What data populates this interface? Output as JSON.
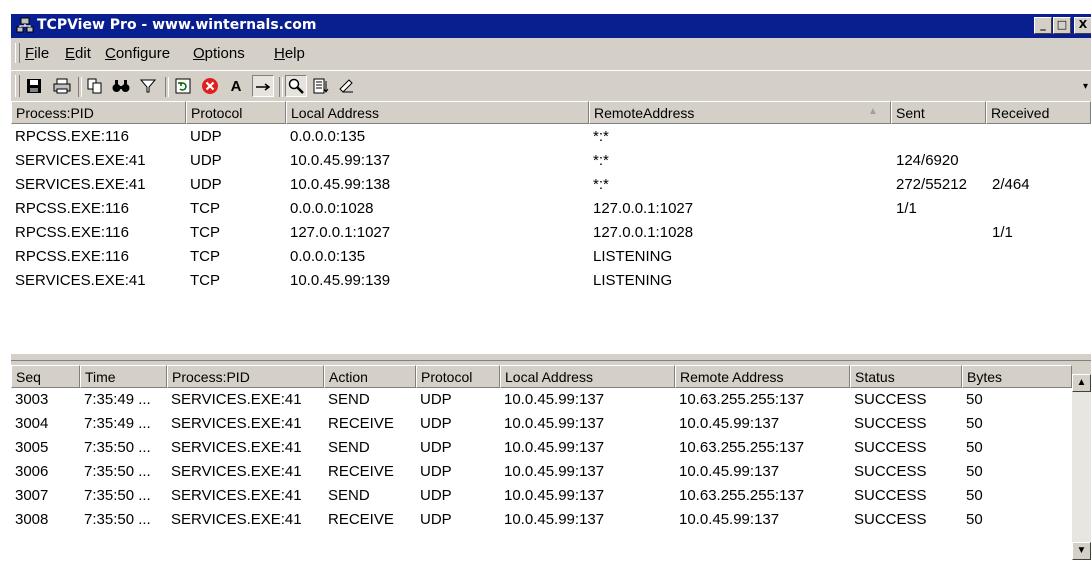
{
  "window": {
    "title": "TCPView Pro - www.winternals.com",
    "controls": {
      "minimize": "_",
      "maximize": "□",
      "close": "X"
    }
  },
  "menu": [
    {
      "label": "File",
      "accel": "F",
      "rest": "ile"
    },
    {
      "label": "Edit",
      "accel": "E",
      "rest": "dit"
    },
    {
      "label": "Configure",
      "accel": "C",
      "rest": "onfigure"
    },
    {
      "label": "Options",
      "accel": "O",
      "rest": "ptions"
    },
    {
      "label": "Help",
      "accel": "H",
      "rest": "elp"
    }
  ],
  "toolbar": {
    "icons": [
      "save-icon",
      "print-icon",
      "copy-icon",
      "find-icon",
      "filter-icon",
      "refresh-icon",
      "close-connection-icon",
      "font-icon",
      "resolve-address-icon",
      "zoom-icon",
      "properties-icon",
      "clear-icon"
    ],
    "font_glyph": "A"
  },
  "connections": {
    "columns": [
      "Process:PID",
      "Protocol",
      "Local Address",
      "RemoteAddress",
      "Sent",
      "Received"
    ],
    "sort_indicator": "▲",
    "rows": [
      {
        "process": "RPCSS.EXE:116",
        "protocol": "UDP",
        "local": "0.0.0.0:135",
        "remote": "*:*",
        "sent": "",
        "received": ""
      },
      {
        "process": "SERVICES.EXE:41",
        "protocol": "UDP",
        "local": "10.0.45.99:137",
        "remote": "*:*",
        "sent": "124/6920",
        "received": ""
      },
      {
        "process": "SERVICES.EXE:41",
        "protocol": "UDP",
        "local": "10.0.45.99:138",
        "remote": "*:*",
        "sent": "272/55212",
        "received": "2/464"
      },
      {
        "process": "RPCSS.EXE:116",
        "protocol": "TCP",
        "local": "0.0.0.0:1028",
        "remote": "127.0.0.1:1027",
        "sent": "1/1",
        "received": ""
      },
      {
        "process": "RPCSS.EXE:116",
        "protocol": "TCP",
        "local": "127.0.0.1:1027",
        "remote": "127.0.0.1:1028",
        "sent": "",
        "received": "1/1"
      },
      {
        "process": "RPCSS.EXE:116",
        "protocol": "TCP",
        "local": "0.0.0.0:135",
        "remote": "LISTENING",
        "sent": "",
        "received": ""
      },
      {
        "process": "SERVICES.EXE:41",
        "protocol": "TCP",
        "local": "10.0.45.99:139",
        "remote": "LISTENING",
        "sent": "",
        "received": ""
      }
    ]
  },
  "log": {
    "columns": [
      "Seq",
      "Time",
      "Process:PID",
      "Action",
      "Protocol",
      "Local Address",
      "Remote Address",
      "Status",
      "Bytes"
    ],
    "rows": [
      {
        "seq": "3003",
        "time": "7:35:49 ...",
        "process": "SERVICES.EXE:41",
        "action": "SEND",
        "protocol": "UDP",
        "local": "10.0.45.99:137",
        "remote": "10.63.255.255:137",
        "status": "SUCCESS",
        "bytes": "50"
      },
      {
        "seq": "3004",
        "time": "7:35:49 ...",
        "process": "SERVICES.EXE:41",
        "action": "RECEIVE",
        "protocol": "UDP",
        "local": "10.0.45.99:137",
        "remote": "10.0.45.99:137",
        "status": "SUCCESS",
        "bytes": "50"
      },
      {
        "seq": "3005",
        "time": "7:35:50 ...",
        "process": "SERVICES.EXE:41",
        "action": "SEND",
        "protocol": "UDP",
        "local": "10.0.45.99:137",
        "remote": "10.63.255.255:137",
        "status": "SUCCESS",
        "bytes": "50"
      },
      {
        "seq": "3006",
        "time": "7:35:50 ...",
        "process": "SERVICES.EXE:41",
        "action": "RECEIVE",
        "protocol": "UDP",
        "local": "10.0.45.99:137",
        "remote": "10.0.45.99:137",
        "status": "SUCCESS",
        "bytes": "50"
      },
      {
        "seq": "3007",
        "time": "7:35:50 ...",
        "process": "SERVICES.EXE:41",
        "action": "SEND",
        "protocol": "UDP",
        "local": "10.0.45.99:137",
        "remote": "10.63.255.255:137",
        "status": "SUCCESS",
        "bytes": "50"
      },
      {
        "seq": "3008",
        "time": "7:35:50 ...",
        "process": "SERVICES.EXE:41",
        "action": "RECEIVE",
        "protocol": "UDP",
        "local": "10.0.45.99:137",
        "remote": "10.0.45.99:137",
        "status": "SUCCESS",
        "bytes": "50"
      }
    ]
  },
  "colors": {
    "titlebar": "#0a1f8f",
    "chrome": "#d4d0c8",
    "close_button": "#e02020"
  }
}
